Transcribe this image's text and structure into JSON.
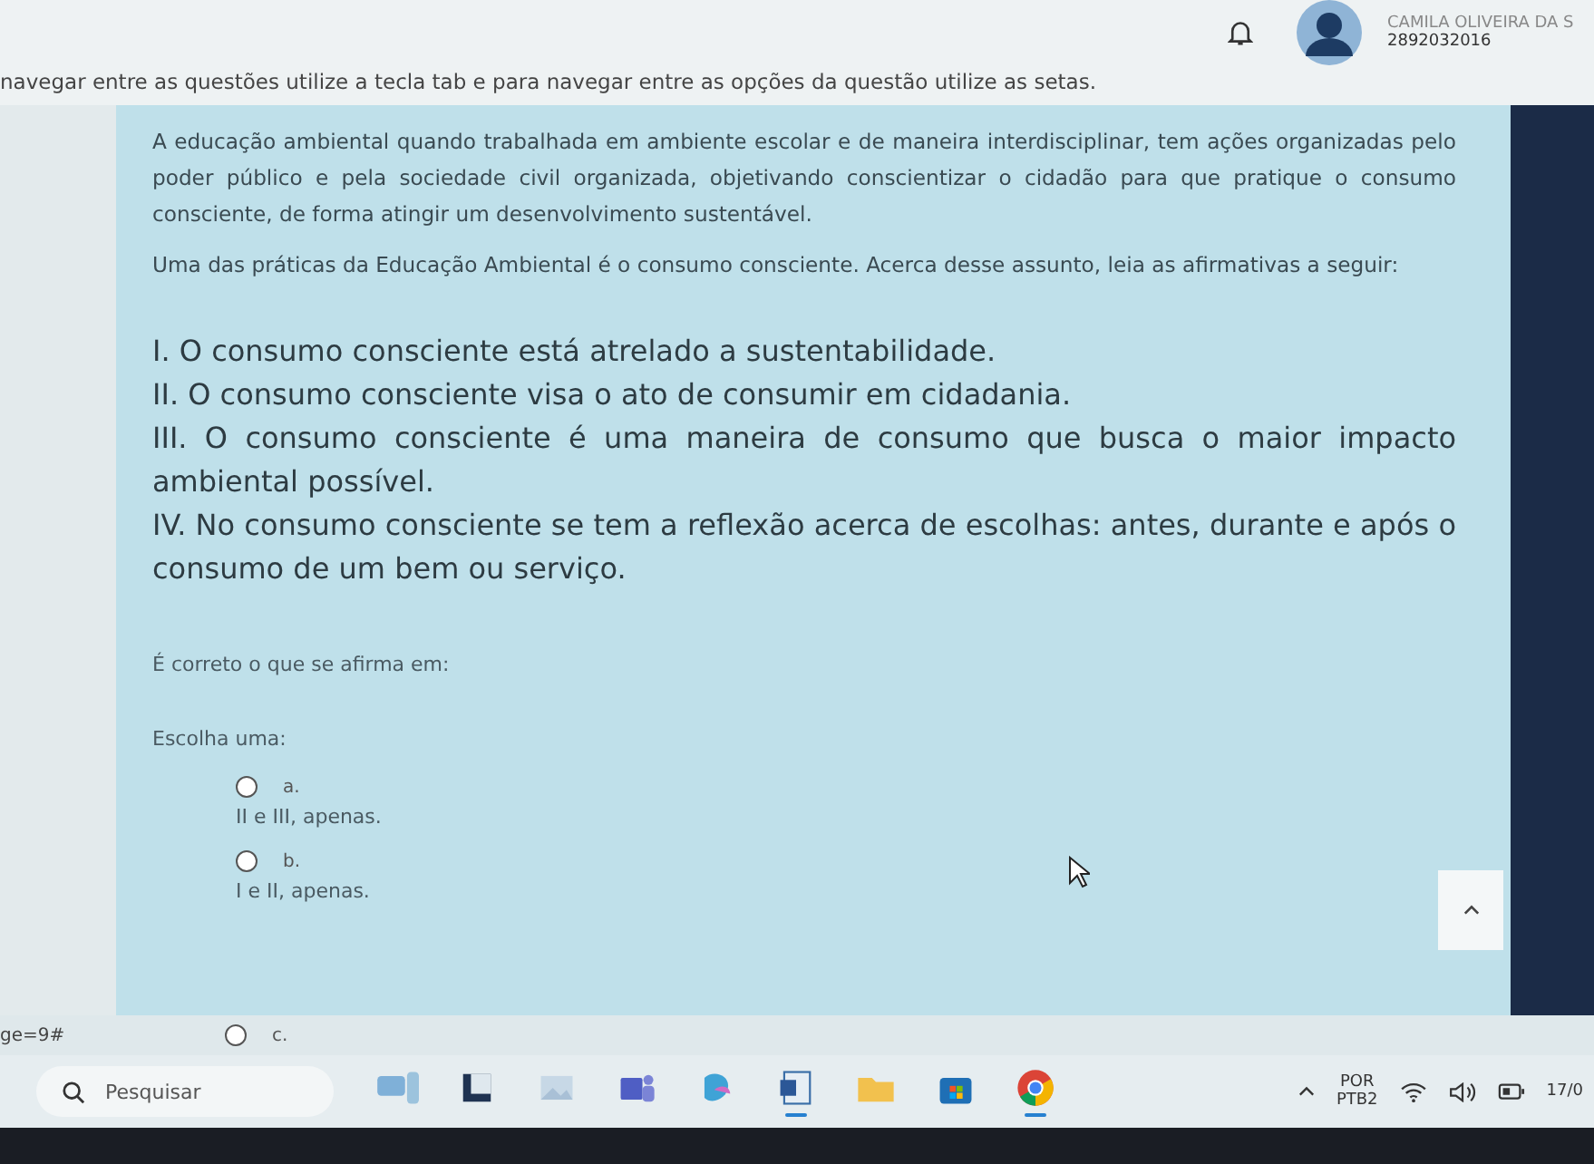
{
  "header": {
    "user_name": "CAMILA OLIVEIRA DA S",
    "user_id": "2892032016"
  },
  "instruction": "navegar entre as questões utilize a tecla tab e para navegar entre as opções da questão utilize as setas.",
  "question": {
    "paragraphs": [
      "A educação ambiental quando trabalhada em ambiente escolar e de maneira interdisciplinar, tem ações organizadas pelo poder público e pela sociedade civil organizada, objetivando conscientizar o cidadão para que pratique o consumo consciente, de forma atingir um desenvolvimento sustentável.",
      "Uma das práticas da Educação Ambiental é o consumo consciente. Acerca desse assunto, leia as afirmativas a seguir:"
    ],
    "statements": [
      "I. O consumo consciente está atrelado a sustentabilidade.",
      "II. O consumo consciente visa o ato de consumir em cidadania.",
      "III. O consumo consciente é uma maneira de consumo que busca o maior impacto ambiental possível.",
      "IV. No consumo consciente se tem a reflexão acerca de escolhas: antes, durante e após o consumo de um bem ou serviço."
    ],
    "prompt": "É correto o que se afirma em:",
    "choose_label": "Escolha uma:",
    "options": [
      {
        "letter": "a.",
        "text": "II e III, apenas.",
        "selected": false
      },
      {
        "letter": "b.",
        "text": "I e II, apenas.",
        "selected": false
      },
      {
        "letter": "c.",
        "selected": false
      }
    ]
  },
  "status_url": "ge=9#",
  "taskbar": {
    "search_placeholder": "Pesquisar",
    "apps": [
      {
        "kind": "widget",
        "running": false
      },
      {
        "kind": "snap",
        "running": false
      },
      {
        "kind": "photo",
        "running": false
      },
      {
        "kind": "teams",
        "running": false
      },
      {
        "kind": "copilot",
        "running": false
      },
      {
        "kind": "word",
        "running": true
      },
      {
        "kind": "folder",
        "running": false
      },
      {
        "kind": "store",
        "running": false
      },
      {
        "kind": "chrome",
        "running": true
      }
    ],
    "language": "POR",
    "layout": "PTB2",
    "clock": "17/0"
  }
}
